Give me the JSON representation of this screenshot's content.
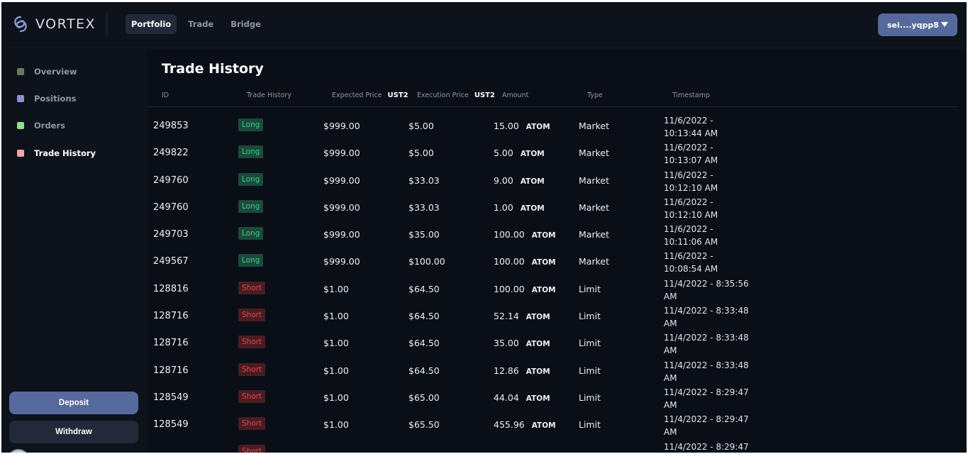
{
  "header": {
    "logo_text": "VORTEX",
    "nav": [
      {
        "label": "Portfolio",
        "active": true
      },
      {
        "label": "Trade",
        "active": false
      },
      {
        "label": "Bridge",
        "active": false
      }
    ],
    "wallet_label": "sei....yqpp8"
  },
  "sidebar": {
    "items": [
      {
        "label": "Overview",
        "color": "#6b7a5a"
      },
      {
        "label": "Positions",
        "color": "#8a8fd0"
      },
      {
        "label": "Orders",
        "color": "#8ee08e"
      },
      {
        "label": "Trade History",
        "color": "#f2a6a6",
        "active": true
      }
    ],
    "deposit_label": "Deposit",
    "withdraw_label": "Withdraw"
  },
  "main": {
    "title": "Trade History",
    "columns": {
      "id": "ID",
      "side": "Trade History",
      "expected": "Expected Price",
      "expected_unit": "UST2",
      "execution": "Execution Price",
      "execution_unit": "UST2",
      "amount": "Amount",
      "type": "Type",
      "timestamp": "Timestamp"
    },
    "rows": [
      {
        "id": "249853",
        "side": "Long",
        "expected": "$999.00",
        "execution": "$5.00",
        "amount": "15.00",
        "asset": "ATOM",
        "type": "Market",
        "timestamp": "11/6/2022 - 10:13:44 AM"
      },
      {
        "id": "249822",
        "side": "Long",
        "expected": "$999.00",
        "execution": "$5.00",
        "amount": "5.00",
        "asset": "ATOM",
        "type": "Market",
        "timestamp": "11/6/2022 - 10:13:07 AM"
      },
      {
        "id": "249760",
        "side": "Long",
        "expected": "$999.00",
        "execution": "$33.03",
        "amount": "9.00",
        "asset": "ATOM",
        "type": "Market",
        "timestamp": "11/6/2022 - 10:12:10 AM"
      },
      {
        "id": "249760",
        "side": "Long",
        "expected": "$999.00",
        "execution": "$33.03",
        "amount": "1.00",
        "asset": "ATOM",
        "type": "Market",
        "timestamp": "11/6/2022 - 10:12:10 AM"
      },
      {
        "id": "249703",
        "side": "Long",
        "expected": "$999.00",
        "execution": "$35.00",
        "amount": "100.00",
        "asset": "ATOM",
        "type": "Market",
        "timestamp": "11/6/2022 - 10:11:06 AM"
      },
      {
        "id": "249567",
        "side": "Long",
        "expected": "$999.00",
        "execution": "$100.00",
        "amount": "100.00",
        "asset": "ATOM",
        "type": "Market",
        "timestamp": "11/6/2022 - 10:08:54 AM"
      },
      {
        "id": "128816",
        "side": "Short",
        "expected": "$1.00",
        "execution": "$64.50",
        "amount": "100.00",
        "asset": "ATOM",
        "type": "Limit",
        "timestamp": "11/4/2022 - 8:35:56 AM"
      },
      {
        "id": "128716",
        "side": "Short",
        "expected": "$1.00",
        "execution": "$64.50",
        "amount": "52.14",
        "asset": "ATOM",
        "type": "Limit",
        "timestamp": "11/4/2022 - 8:33:48 AM"
      },
      {
        "id": "128716",
        "side": "Short",
        "expected": "$1.00",
        "execution": "$64.50",
        "amount": "35.00",
        "asset": "ATOM",
        "type": "Limit",
        "timestamp": "11/4/2022 - 8:33:48 AM"
      },
      {
        "id": "128716",
        "side": "Short",
        "expected": "$1.00",
        "execution": "$64.50",
        "amount": "12.86",
        "asset": "ATOM",
        "type": "Limit",
        "timestamp": "11/4/2022 - 8:33:48 AM"
      },
      {
        "id": "128549",
        "side": "Short",
        "expected": "$1.00",
        "execution": "$65.00",
        "amount": "44.04",
        "asset": "ATOM",
        "type": "Limit",
        "timestamp": "11/4/2022 - 8:29:47 AM"
      },
      {
        "id": "128549",
        "side": "Short",
        "expected": "$1.00",
        "execution": "$65.50",
        "amount": "455.96",
        "asset": "ATOM",
        "type": "Limit",
        "timestamp": "11/4/2022 - 8:29:47 AM"
      },
      {
        "id": "",
        "side": "Short",
        "expected": "",
        "execution": "",
        "amount": "",
        "asset": "",
        "type": "",
        "timestamp": "11/4/2022 - 8:29:47"
      }
    ]
  },
  "colors": {
    "accent": "#56699c",
    "long": "#2fd18b",
    "short": "#e2454f"
  }
}
